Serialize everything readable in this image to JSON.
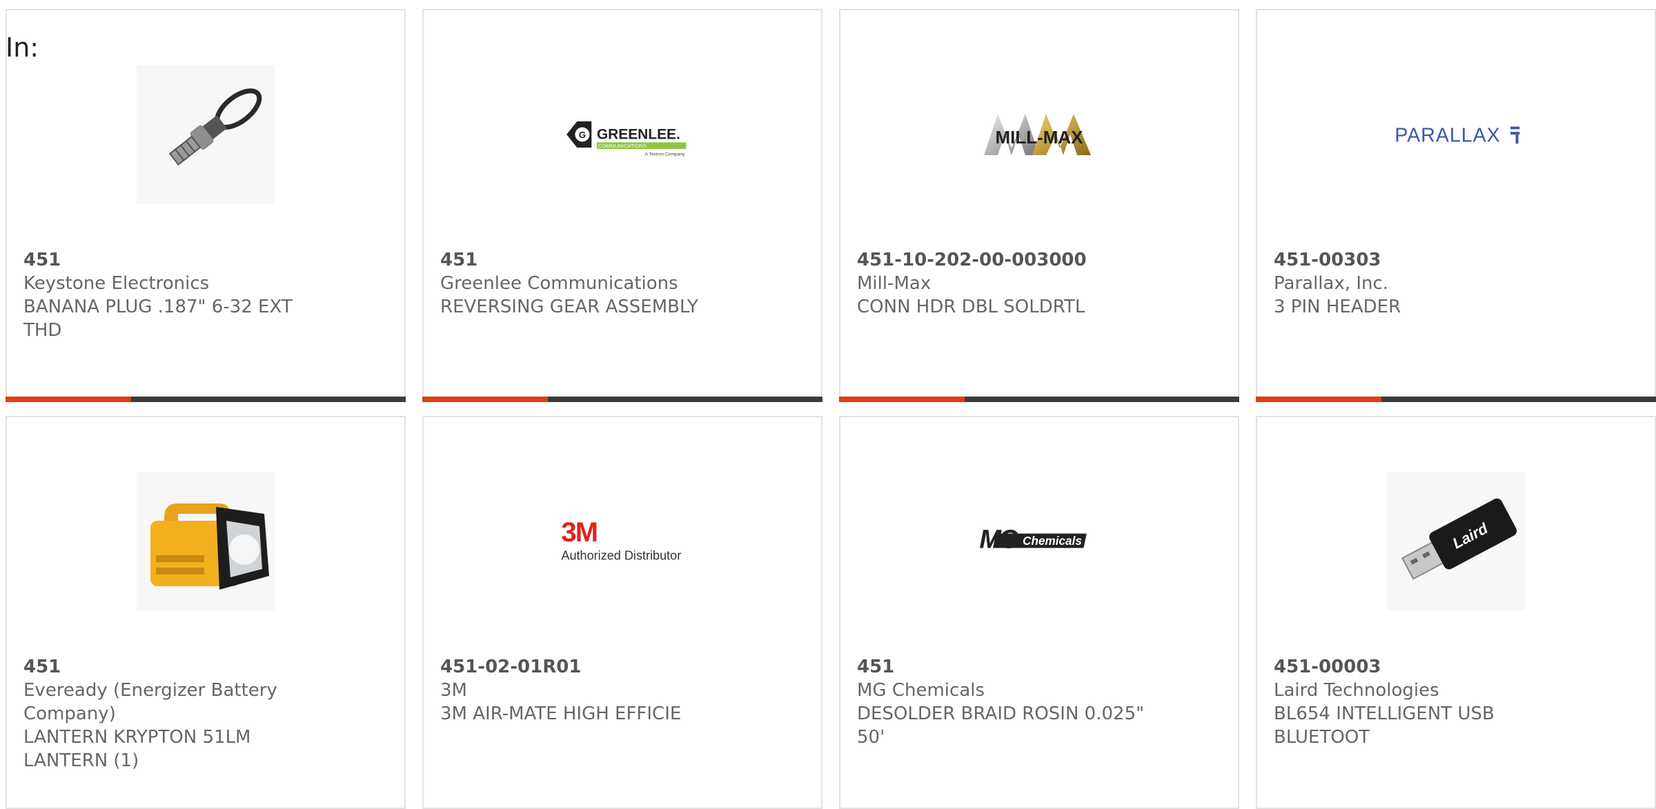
{
  "filter_label": "In:",
  "products": [
    {
      "part_number": "451",
      "manufacturer": "Keystone Electronics",
      "description": "BANANA PLUG .187\" 6-32 EXT THD",
      "image": "banana-plug-photo"
    },
    {
      "part_number": "451",
      "manufacturer": "Greenlee Communications",
      "description": "REVERSING GEAR ASSEMBLY",
      "image": "greenlee-logo",
      "logo_text": "GREENLEE.",
      "logo_sub": "COMMUNICATIONS",
      "logo_tag": "A Textron Company"
    },
    {
      "part_number": "451-10-202-00-003000",
      "manufacturer": "Mill-Max",
      "description": "CONN HDR DBL SOLDRTL",
      "image": "mill-max-logo",
      "logo_text": "MILL-MAX"
    },
    {
      "part_number": "451-00303",
      "manufacturer": "Parallax, Inc.",
      "description": "3 PIN HEADER",
      "image": "parallax-logo",
      "logo_text": "PARALLAX"
    },
    {
      "part_number": "451",
      "manufacturer": "Eveready (Energizer Battery Company)",
      "description": "LANTERN KRYPTON 51LM LANTERN (1)",
      "image": "lantern-photo"
    },
    {
      "part_number": "451-02-01R01",
      "manufacturer": "3M",
      "description": "3M AIR-MATE HIGH EFFICIE",
      "image": "3m-logo",
      "logo_text": "3M",
      "logo_sub": "Authorized Distributor"
    },
    {
      "part_number": "451",
      "manufacturer": "MG Chemicals",
      "description": "DESOLDER BRAID ROSIN 0.025\" 50'",
      "image": "mg-chemicals-logo",
      "logo_text": "MG",
      "logo_sub": "Chemicals"
    },
    {
      "part_number": "451-00003",
      "manufacturer": "Laird Technologies",
      "description": "BL654 INTELLIGENT USB BLUETOOT",
      "image": "laird-usb-photo",
      "logo_text": "Laird"
    }
  ],
  "colors": {
    "accent": "#e23c12",
    "bar": "#3b3b3b",
    "border": "#e2e2e2",
    "text": "#666666"
  }
}
